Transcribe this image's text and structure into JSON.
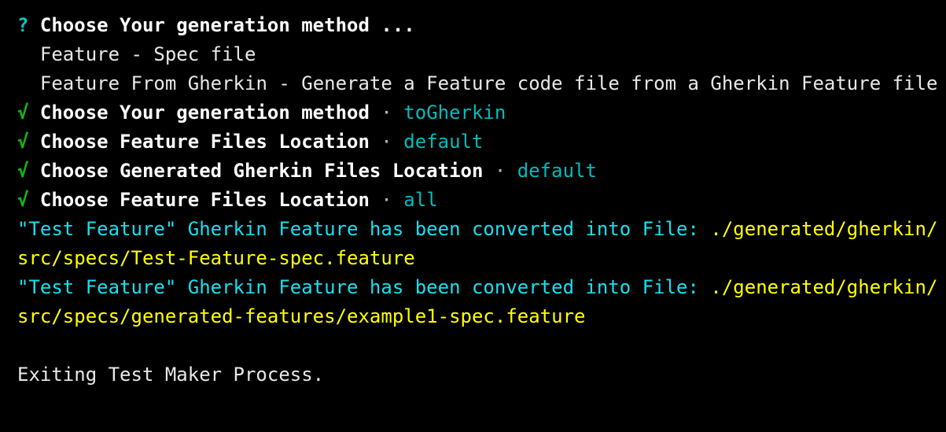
{
  "terminal": {
    "background_color": "#000000",
    "colors": {
      "prompt_cyan": "#00c8c8",
      "check_green": "#13b513",
      "label_white": "#ffffff",
      "plain_white": "#e8e8e8",
      "separator_grey": "#b9b9b9",
      "value_teal": "#00bcbc",
      "message_cyan": "#16e0f0",
      "path_yellow": "#ffff00"
    },
    "lines": [
      {
        "name": "prompt-question",
        "type": "prompt",
        "marker": "?",
        "text": "Choose Your generation method ..."
      },
      {
        "name": "menu-option-1",
        "type": "option",
        "indent": "  ",
        "text": "Feature - Spec file"
      },
      {
        "name": "menu-option-2",
        "type": "option",
        "indent": "  ",
        "text": "Feature From Gherkin - Generate a Feature code file from a Gherkin Feature file"
      },
      {
        "name": "answered-generation-method",
        "type": "answer",
        "marker": "√",
        "label": "Choose Your generation method",
        "separator": "·",
        "value": "toGherkin"
      },
      {
        "name": "answered-feature-files-location",
        "type": "answer",
        "marker": "√",
        "label": "Choose Feature Files Location",
        "separator": "·",
        "value": "default"
      },
      {
        "name": "answered-generated-gherkin-files-location",
        "type": "answer",
        "marker": "√",
        "label": "Choose Generated Gherkin Files Location",
        "separator": "·",
        "value": "default"
      },
      {
        "name": "answered-feature-files-selection",
        "type": "answer",
        "marker": "√",
        "label": "Choose Feature Files Location",
        "separator": "·",
        "value": "all"
      },
      {
        "name": "conversion-result-1",
        "type": "conversion",
        "message": "\"Test Feature\" Gherkin Feature has been converted into File: ",
        "path": "./generated/gherkin/src/specs/Test-Feature-spec.feature"
      },
      {
        "name": "conversion-result-2",
        "type": "conversion",
        "message": "\"Test Feature\" Gherkin Feature has been converted into File: ",
        "path": "./generated/gherkin/src/specs/generated-features/example1-spec.feature"
      },
      {
        "name": "blank-separator",
        "type": "blank",
        "text": ""
      },
      {
        "name": "exit-message",
        "type": "plain",
        "text": "Exiting Test Maker Process."
      }
    ]
  }
}
